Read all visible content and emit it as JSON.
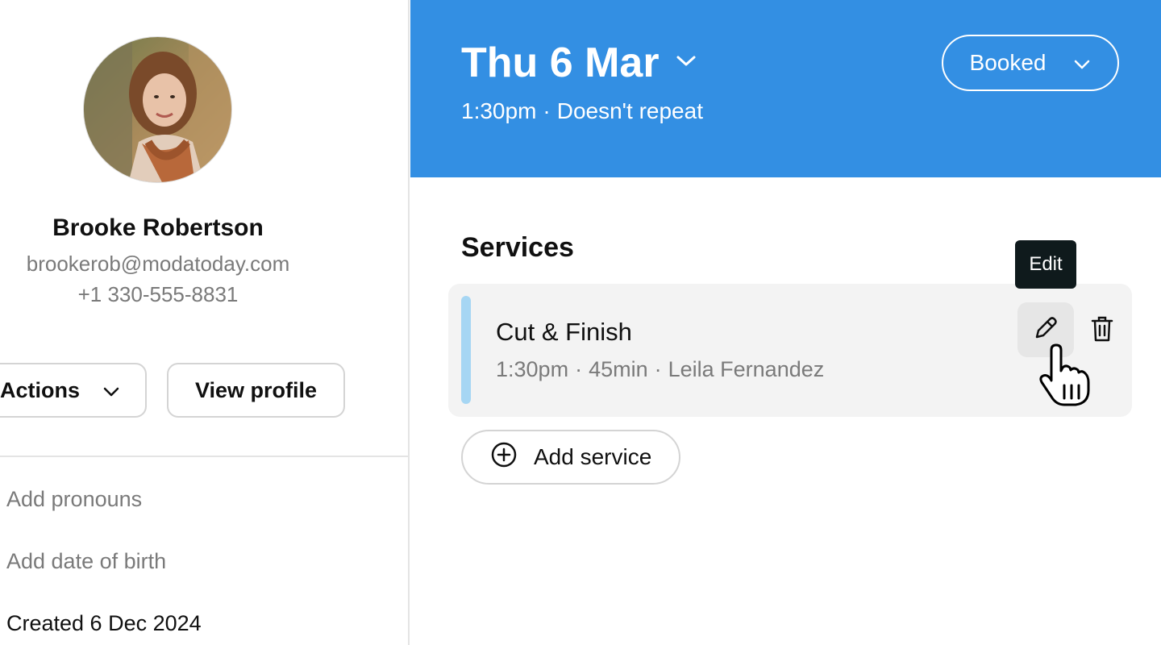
{
  "client": {
    "name": "Brooke Robertson",
    "email": "brookerob@modatoday.com",
    "phone": "+1 330-555-8831",
    "actions_label": "Actions",
    "view_profile_label": "View profile",
    "add_pronouns": "Add pronouns",
    "add_dob": "Add date of birth",
    "created": "Created 6 Dec 2024"
  },
  "appointment": {
    "date": "Thu 6 Mar",
    "time": "1:30pm",
    "separator": "·",
    "repeat": "Doesn't repeat",
    "status": "Booked",
    "header_color": "#338fe3"
  },
  "services": {
    "heading": "Services",
    "items": [
      {
        "name": "Cut & Finish",
        "time": "1:30pm",
        "duration": "45min",
        "staff": "Leila Fernandez",
        "color": "#a6d6f3"
      }
    ],
    "edit_tooltip": "Edit",
    "add_label": "Add service"
  },
  "icons": {
    "date_dropdown": "chevron-down-icon",
    "status_dropdown": "chevron-down-icon",
    "edit": "pencil-icon",
    "delete": "trash-icon",
    "add": "plus-circle-icon",
    "cursor": "hand-pointer-icon"
  }
}
